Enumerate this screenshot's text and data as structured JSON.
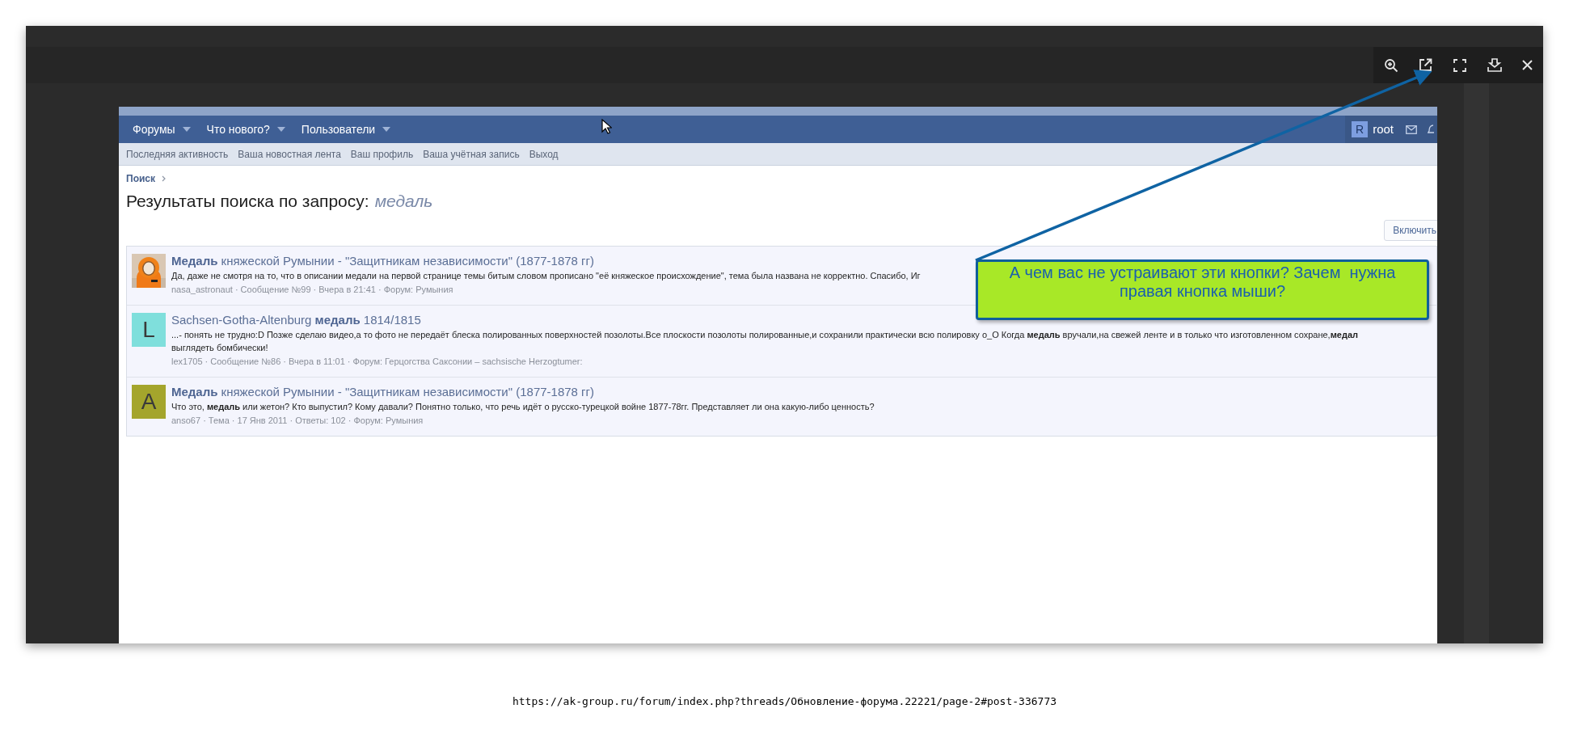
{
  "forum": {
    "nav_tabs": [
      {
        "label": "Форумы"
      },
      {
        "label": "Что нового?"
      },
      {
        "label": "Пользователи"
      }
    ],
    "user": {
      "initial": "R",
      "name": "root"
    },
    "sub_nav": [
      "Последняя активность",
      "Ваша новостная лента",
      "Ваш профиль",
      "Ваша учётная запись",
      "Выход"
    ],
    "breadcrumb": "Поиск",
    "title": "Результаты поиска по запросу:",
    "query": "медаль",
    "filter_button": "Включить",
    "results": [
      {
        "avatar": {
          "kind": "picture"
        },
        "title": "**Медаль** княжеской Румынии - \"Защитникам независимости\" (1877-1878 гг)",
        "snippet_lines": [
          "Да, даже не смотря на то, что в описании медали на первой странице темы битым словом прописано \"её княжеское происхождение\", тема была названа не корректно. Спасибо, Иг"
        ],
        "meta": "nasa_astronaut · Сообщение №99 · Вчера в 21:41 · Форум: Румыния"
      },
      {
        "avatar": {
          "kind": "letter",
          "letter": "L",
          "color": "#7fdfdc"
        },
        "title": "Sachsen-Gotha-Altenburg **медаль** 1814/1815",
        "snippet_lines": [
          "...- понять не трудно:D Позже сделаю видео,а то фото не передаёт блеска полированных поверхностей позолоты.Все плоскости позолоты полированные,и сохранили практически всю полировку о_О Когда **медаль** вручали,на свежей ленте и в только что изготовленном сохране,**медал**",
          "выглядеть бомбически!"
        ],
        "meta": "lex1705 · Сообщение №86 · Вчера в 11:01 · Форум: Герцогства Саксонии – sachsische Herzogtumer:"
      },
      {
        "avatar": {
          "kind": "letter",
          "letter": "A",
          "color": "#a4a52c"
        },
        "title": "**Медаль** княжеской Румынии - \"Защитникам независимости\" (1877-1878 гг)",
        "snippet_lines": [
          "Что это, **медаль** или жетон? Кто выпустил? Кому давали? Понятно только, что речь идёт о русско-турецкой войне 1877-78гг. Представляет ли она какую-либо ценность?"
        ],
        "meta": "anso67 · Тема · 17 Янв 2011 · Ответы: 102 · Форум: Румыния"
      }
    ]
  },
  "callout": "А чем вас не устраивают эти кнопки? Зачем  нужна правая кнопка мыши?",
  "url": "https://ak-group.ru/forum/index.php?threads/Обновление-форума.22221/page-2#post-336773"
}
